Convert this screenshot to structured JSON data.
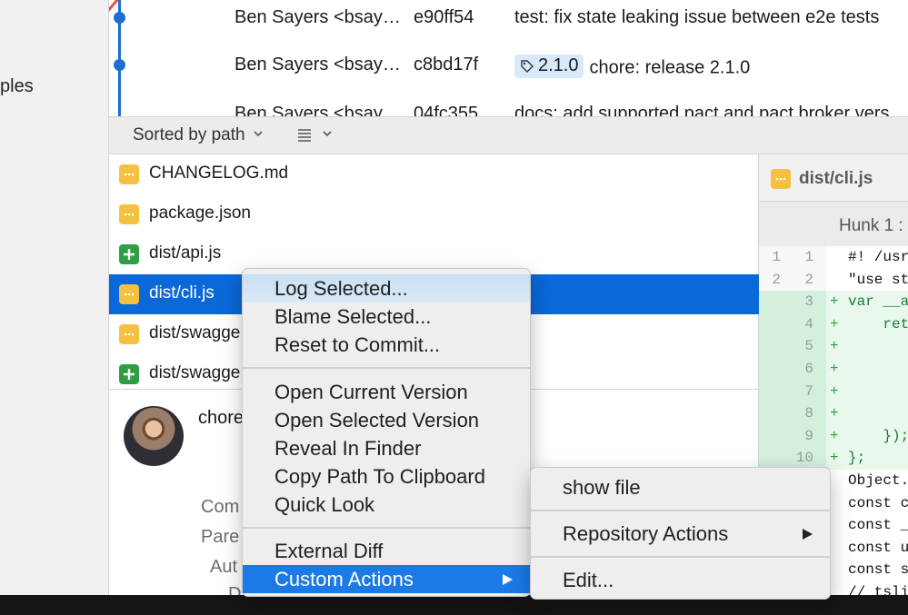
{
  "sidebar": {
    "partial_label": "ples"
  },
  "commits": [
    {
      "author": "Ben Sayers <bsay…",
      "sha": "e90ff54",
      "message": "test: fix state leaking issue between e2e tests",
      "tag": ""
    },
    {
      "author": "Ben Sayers <bsay…",
      "sha": "c8bd17f",
      "message": "chore: release 2.1.0",
      "tag": "2.1.0"
    },
    {
      "author": "Ben Sayers <bsay…",
      "sha": "04fc355",
      "message": "docs: add supported pact and pact broker vers",
      "tag": ""
    }
  ],
  "toolbar": {
    "sort_label": "Sorted by path"
  },
  "files": [
    {
      "name": "CHANGELOG.md",
      "status": "modified"
    },
    {
      "name": "package.json",
      "status": "modified"
    },
    {
      "name": "dist/api.js",
      "status": "added"
    },
    {
      "name": "dist/cli.js",
      "status": "modified",
      "selected": true
    },
    {
      "name": "dist/swagge",
      "status": "modified"
    },
    {
      "name": "dist/swagge",
      "status": "added"
    }
  ],
  "detail": {
    "subject": "chore",
    "meta": [
      "Com",
      "Pare",
      "Aut",
      "D"
    ]
  },
  "diff": {
    "file": "dist/cli.js",
    "hunk_label": "Hunk 1 :",
    "lines": [
      {
        "old": "1",
        "new": "1",
        "mark": "",
        "code": "#! /usr",
        "added": false
      },
      {
        "old": "2",
        "new": "2",
        "mark": "",
        "code": "\"use st",
        "added": false
      },
      {
        "old": "",
        "new": "3",
        "mark": "+",
        "code": "var __a",
        "added": true
      },
      {
        "old": "",
        "new": "4",
        "mark": "+",
        "code": "    ret",
        "added": true
      },
      {
        "old": "",
        "new": "5",
        "mark": "+",
        "code": "",
        "added": true
      },
      {
        "old": "",
        "new": "6",
        "mark": "+",
        "code": "",
        "added": true
      },
      {
        "old": "",
        "new": "7",
        "mark": "+",
        "code": "",
        "added": true
      },
      {
        "old": "",
        "new": "8",
        "mark": "+",
        "code": "",
        "added": true
      },
      {
        "old": "",
        "new": "9",
        "mark": "+",
        "code": "    });",
        "added": true
      },
      {
        "old": "",
        "new": "10",
        "mark": "+",
        "code": "};",
        "added": true
      },
      {
        "old": "",
        "new": "",
        "mark": "",
        "code": "Object.",
        "added": false
      },
      {
        "old": "",
        "new": "",
        "mark": "",
        "code": "const c",
        "added": false
      },
      {
        "old": "",
        "new": "",
        "mark": "",
        "code": "const _",
        "added": false
      },
      {
        "old": "",
        "new": "",
        "mark": "",
        "code": "const u",
        "added": false
      },
      {
        "old": "",
        "new": "",
        "mark": "",
        "code": "const s",
        "added": false
      },
      {
        "old": "",
        "new": "",
        "mark": "",
        "code": "// tsli",
        "added": false
      }
    ]
  },
  "context_menu": {
    "group1": [
      "Log Selected...",
      "Blame Selected...",
      "Reset to Commit..."
    ],
    "group2": [
      "Open Current Version",
      "Open Selected Version",
      "Reveal In Finder",
      "Copy Path To Clipboard",
      "Quick Look"
    ],
    "group3": [
      "External Diff",
      "Custom Actions"
    ]
  },
  "submenu": {
    "items": [
      "show file",
      "Repository Actions",
      "Edit..."
    ]
  },
  "colors": {
    "accent": "#0a68d8",
    "modified": "#f5c040",
    "added": "#2ea043",
    "graph": "#1c6fd0"
  }
}
